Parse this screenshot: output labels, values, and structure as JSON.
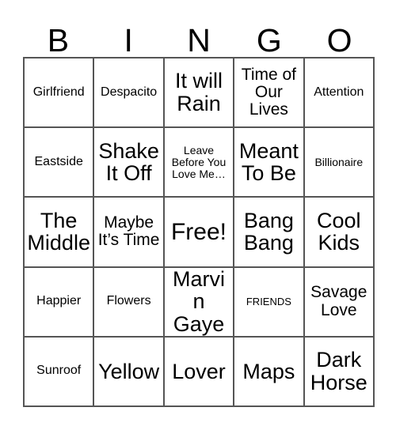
{
  "card": {
    "title_letters": [
      "B",
      "I",
      "N",
      "G",
      "O"
    ],
    "columns": [
      "B",
      "I",
      "N",
      "G",
      "O"
    ],
    "free_space": "Free!",
    "grid_line_color": "#555555",
    "background_color": "#ffffff",
    "text_color": "#000000",
    "rows": [
      [
        {
          "label": "Girlfriend",
          "size": "sm"
        },
        {
          "label": "Despacito",
          "size": "sm"
        },
        {
          "label": "It will Rain",
          "size": "lg"
        },
        {
          "label": "Time of Our Lives",
          "size": "md"
        },
        {
          "label": "Attention",
          "size": "sm"
        }
      ],
      [
        {
          "label": "Eastside",
          "size": "sm"
        },
        {
          "label": "Shake It Off",
          "size": "lg"
        },
        {
          "label": "Leave Before You Love Me…",
          "size": "xs"
        },
        {
          "label": "Meant To Be",
          "size": "lg"
        },
        {
          "label": "Billionaire",
          "size": "xs"
        }
      ],
      [
        {
          "label": "The Middle",
          "size": "lg"
        },
        {
          "label": "Maybe It’s Time",
          "size": "md"
        },
        {
          "label": "Free!",
          "size": "xl"
        },
        {
          "label": "Bang Bang",
          "size": "lg"
        },
        {
          "label": "Cool Kids",
          "size": "lg"
        }
      ],
      [
        {
          "label": "Happier",
          "size": "sm"
        },
        {
          "label": "Flowers",
          "size": "sm"
        },
        {
          "label": "Marvin Gaye",
          "size": "lg"
        },
        {
          "label": "FRIENDS",
          "size": "xxs"
        },
        {
          "label": "Savage Love",
          "size": "md"
        }
      ],
      [
        {
          "label": "Sunroof",
          "size": "sm"
        },
        {
          "label": "Yellow",
          "size": "lg"
        },
        {
          "label": "Lover",
          "size": "lg"
        },
        {
          "label": "Maps",
          "size": "lg"
        },
        {
          "label": "Dark Horse",
          "size": "lg"
        }
      ]
    ]
  }
}
